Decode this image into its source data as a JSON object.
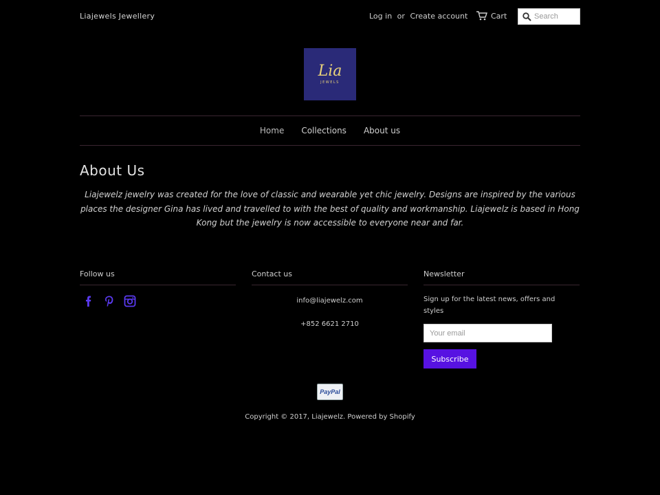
{
  "header": {
    "store_name": "Liajewels Jewellery",
    "login": "Log in",
    "or": "or",
    "create_account": "Create account",
    "cart": "Cart",
    "search_placeholder": "Search"
  },
  "logo": {
    "word": "Lia",
    "sub": "JEWELS"
  },
  "nav": {
    "items": [
      "Home",
      "Collections",
      "About us"
    ]
  },
  "main": {
    "title": "About Us",
    "text": "Liajewelz jewelry was created for the love of classic and wearable yet chic jewelry. Designs are inspired by the various places the designer Gina has lived and travelled to with the best of quality and workmanship. Liajewelz is based in Hong Kong but the jewelry is now accessible to everyone near and far."
  },
  "footer": {
    "follow_title": "Follow us",
    "social_icons": [
      "facebook-icon",
      "pinterest-icon",
      "instagram-icon"
    ],
    "contact_title": "Contact us",
    "email": "info@liajewelz.com",
    "phone": "+852 6621 2710",
    "newsletter_title": "Newsletter",
    "newsletter_text": "Sign up for the latest news, offers and styles",
    "email_placeholder": "Your email",
    "subscribe": "Subscribe",
    "payment": "PayPal",
    "copyright": "Copyright © 2017, Liajewelz. Powered by Shopify"
  },
  "colors": {
    "background": "#000000",
    "accent": "#5712e2",
    "logo_bg": "#2a2a78",
    "divider": "#3a2631"
  }
}
